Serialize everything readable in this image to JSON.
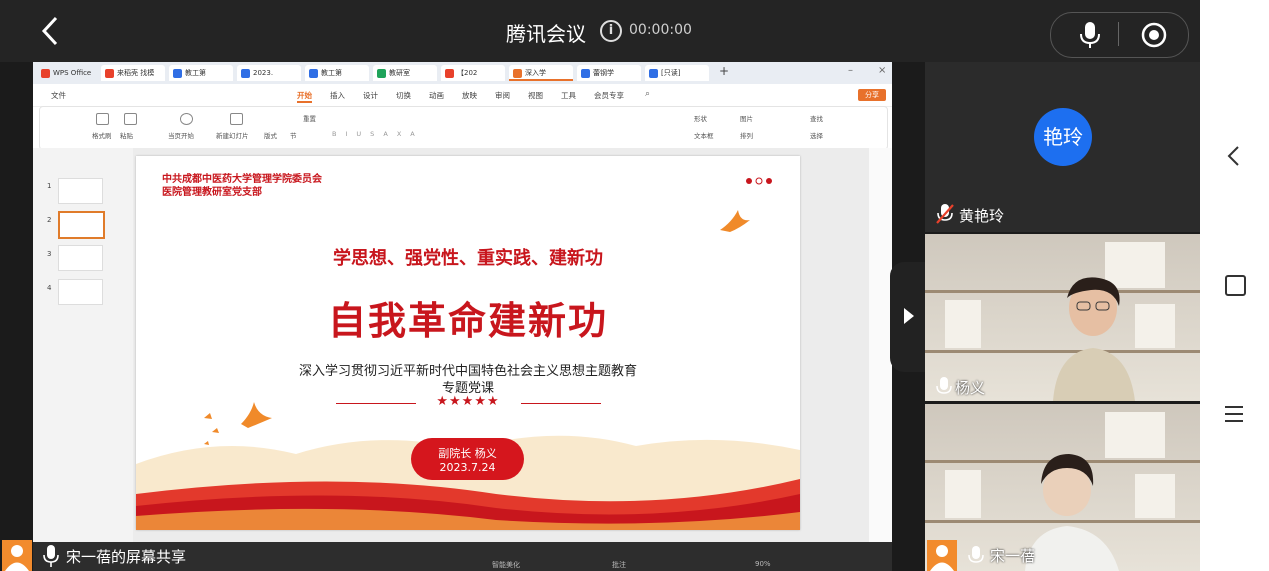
{
  "meeting": {
    "app_title": "腾讯会议",
    "timer": "00:00:00",
    "share_label": "宋一蓓的屏幕共享"
  },
  "wps": {
    "tabs": [
      "WPS Office",
      "来稻壳 找模",
      "教工第",
      "2023.",
      "教工第",
      "教研室",
      "【202",
      "深入学",
      "蕾钢学",
      "[只读]"
    ],
    "menu": [
      "文件",
      "开始",
      "插入",
      "设计",
      "切换",
      "动画",
      "放映",
      "审阅",
      "视图",
      "工具",
      "会员专享"
    ],
    "share_button": "分享",
    "ribbon": {
      "format_painter": "格式刷",
      "paste": "粘贴",
      "play_current": "当页开始",
      "new_slide": "新建幻灯片",
      "layout": "版式",
      "section": "节",
      "reset": "重置",
      "shape": "形状",
      "picture": "图片",
      "textbox": "文本框",
      "arrange": "排列",
      "find": "查找",
      "select": "选择"
    },
    "slide_numbers": [
      "1",
      "2",
      "3",
      "4"
    ],
    "status": {
      "smart_beautify": "智能美化",
      "notes": "批注",
      "zoom": "90%"
    }
  },
  "slide": {
    "org_line1": "中共成都中医药大学管理学院委员会",
    "org_line2": "医院管理教研室党支部",
    "slogan": "学思想、强党性、重实践、建新功",
    "main_title": "自我革命建新功",
    "subtitle1": "深入学习贯彻习近平新时代中国特色社会主义思想主题教育",
    "subtitle2": "专题党课",
    "stars": "★★★★★",
    "speaker": "副院长 杨义",
    "date": "2023.7.24"
  },
  "participants": [
    {
      "name": "黄艳玲",
      "avatar_text": "艳玲",
      "avatar_color": "#1d6ff0",
      "muted": true
    },
    {
      "name": "杨义",
      "video": true
    },
    {
      "name": "宋一蓓",
      "video": true
    }
  ],
  "colors": {
    "accent_red": "#c8161d",
    "wps_orange": "#e8712b",
    "share_orange": "#f28b2d"
  }
}
